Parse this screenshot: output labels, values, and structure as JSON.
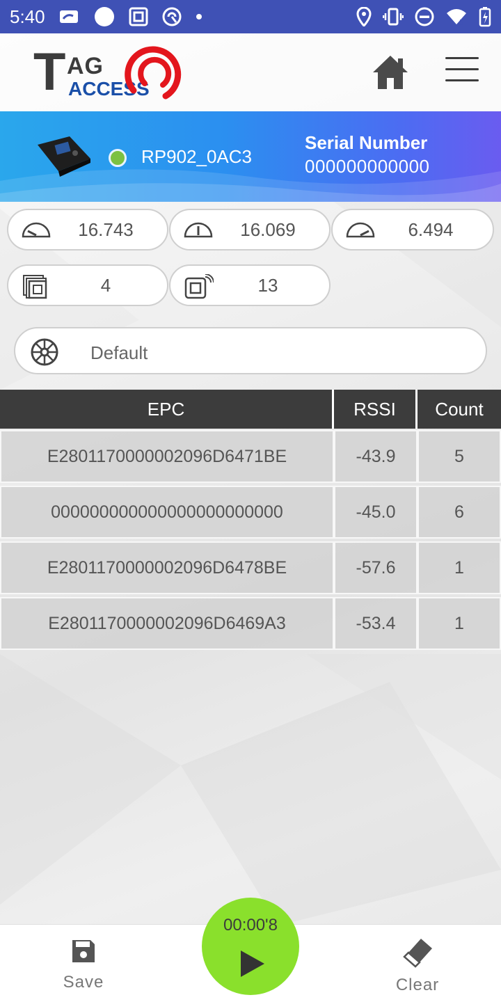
{
  "status_bar": {
    "time": "5:40",
    "icons_left": [
      "card-icon",
      "circle-icon",
      "nfc-tag-icon",
      "vpn-icon",
      "dot-icon"
    ],
    "icons_right": [
      "location-icon",
      "vibrate-icon",
      "dnd-icon",
      "wifi-icon",
      "battery-charging-icon"
    ],
    "background": "#3f51b5"
  },
  "header": {
    "logo_T": "T",
    "logo_AG": "AG",
    "logo_ACCESS": "ACCESS",
    "brand_red": "#e3161d",
    "brand_blue": "#1a4fa8",
    "home_icon": "home-icon",
    "menu_icon": "hamburger-menu-icon"
  },
  "device": {
    "name": "RP902_0AC3",
    "status_color": "#7cc142",
    "serial_label": "Serial Number",
    "serial_value": "000000000000"
  },
  "stats": [
    {
      "icon": "speedometer-low-icon",
      "value": "16.743"
    },
    {
      "icon": "speedometer-mid-icon",
      "value": "16.069"
    },
    {
      "icon": "speedometer-high-icon",
      "value": "6.494"
    },
    {
      "icon": "tags-stack-icon",
      "value": "4"
    },
    {
      "icon": "tag-read-icon",
      "value": "13"
    }
  ],
  "mode": {
    "icon": "steering-wheel-icon",
    "value": "Default"
  },
  "table": {
    "headers": [
      "EPC",
      "RSSI",
      "Count"
    ],
    "rows": [
      {
        "epc": "E2801170000002096D6471BE",
        "rssi": "-43.9",
        "count": "5"
      },
      {
        "epc": "000000000000000000000000",
        "rssi": "-45.0",
        "count": "6"
      },
      {
        "epc": "E2801170000002096D6478BE",
        "rssi": "-57.6",
        "count": "1"
      },
      {
        "epc": "E2801170000002096D6469A3",
        "rssi": "-53.4",
        "count": "1"
      }
    ]
  },
  "bottom": {
    "save_label": "Save",
    "clear_label": "Clear",
    "timer": "00:00'8",
    "play_color": "#8ae02c"
  }
}
